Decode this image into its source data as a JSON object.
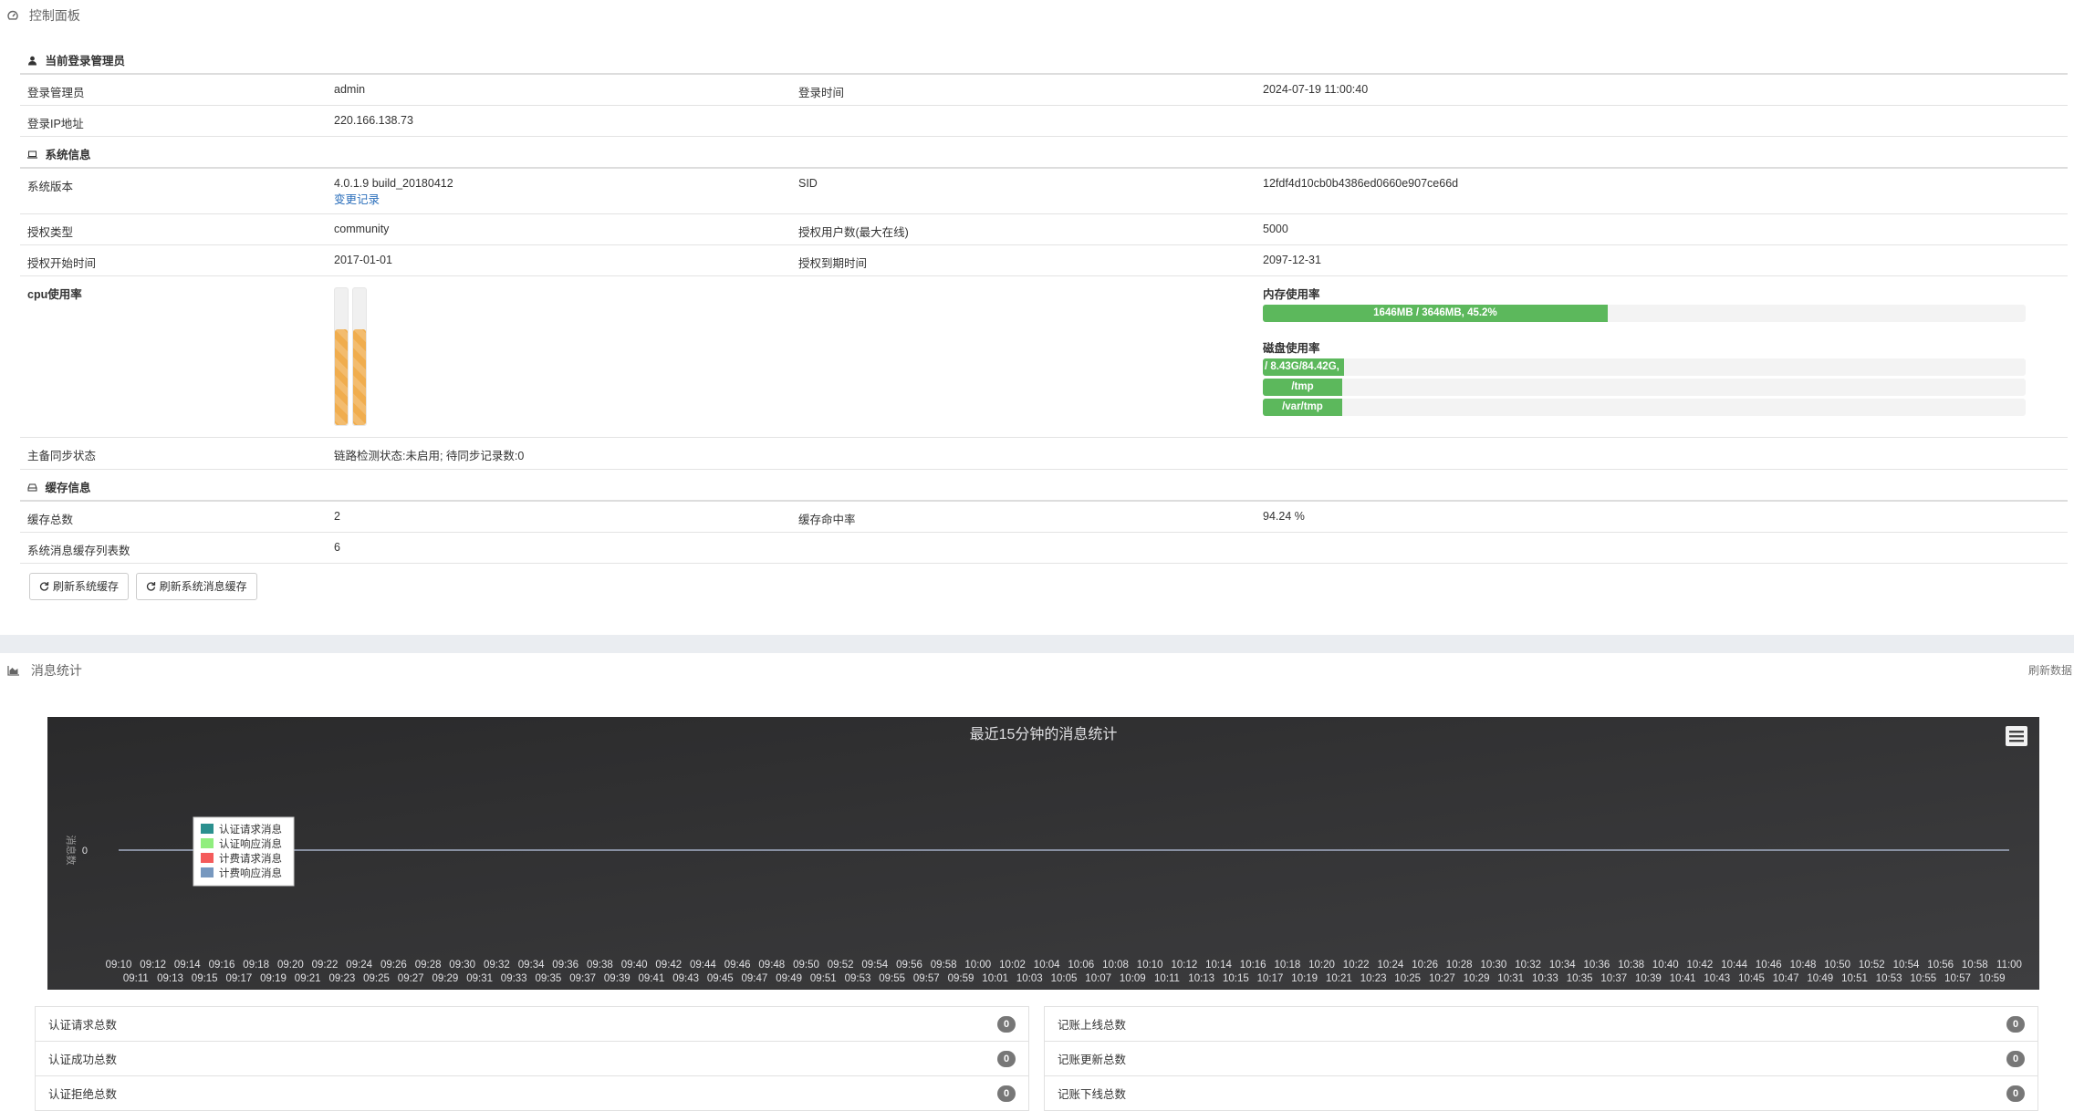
{
  "dashboard": {
    "title": "控制面板"
  },
  "admin_section": {
    "title": "当前登录管理员",
    "login_admin_label": "登录管理员",
    "login_admin_value": "admin",
    "login_time_label": "登录时间",
    "login_time_value": "2024-07-19 11:00:40",
    "login_ip_label": "登录IP地址",
    "login_ip_value": "220.166.138.73"
  },
  "system_section": {
    "title": "系统信息",
    "version_label": "系统版本",
    "version_value": "4.0.1.9 build_20180412",
    "changelog_link": "变更记录",
    "sid_label": "SID",
    "sid_value": "12fdf4d10cb0b4386ed0660e907ce66d",
    "license_type_label": "授权类型",
    "license_type_value": "community",
    "license_users_label": "授权用户数(最大在线)",
    "license_users_value": "5000",
    "license_start_label": "授权开始时间",
    "license_start_value": "2017-01-01",
    "license_end_label": "授权到期时间",
    "license_end_value": "2097-12-31",
    "cpu_label": "cpu使用率",
    "cpu_usage": [
      0.7,
      0.7
    ],
    "mem_label": "内存使用率",
    "mem_text": "1646MB / 3646MB, 45.2%",
    "mem_fraction": 0.452,
    "disk_label": "磁盘使用率",
    "disks": [
      {
        "text": "/ 8.43G/84.42G,",
        "fraction": 0.104
      },
      {
        "text": "/tmp",
        "fraction": 0.104
      },
      {
        "text": "/var/tmp",
        "fraction": 0.104
      }
    ],
    "sync_label": "主备同步状态",
    "sync_value": "链路检测状态:未启用; 待同步记录数:0"
  },
  "cache_section": {
    "title": "缓存信息",
    "total_label": "缓存总数",
    "total_value": "2",
    "hit_label": "缓存命中率",
    "hit_value": "94.24 %",
    "msg_cache_label": "系统消息缓存列表数",
    "msg_cache_value": "6"
  },
  "buttons": {
    "refresh_cache": "刷新系统缓存",
    "refresh_msg_cache": "刷新系统消息缓存"
  },
  "message_stats": {
    "title": "消息统计",
    "refresh_link": "刷新数据"
  },
  "chart_data": {
    "type": "line",
    "title": "最近15分钟的消息统计",
    "ylabel": "消息数",
    "xlabel": "",
    "y_ticks": [
      "0"
    ],
    "x": [
      "09:10",
      "09:11",
      "09:12",
      "09:13",
      "09:14",
      "09:15",
      "09:16",
      "09:17",
      "09:18",
      "09:19",
      "09:20",
      "09:21",
      "09:22",
      "09:23",
      "09:24",
      "09:25",
      "09:26",
      "09:27",
      "09:28",
      "09:29",
      "09:30",
      "09:31",
      "09:32",
      "09:33",
      "09:34",
      "09:35",
      "09:36",
      "09:37",
      "09:38",
      "09:39",
      "09:40",
      "09:41",
      "09:42",
      "09:43",
      "09:44",
      "09:45",
      "09:46",
      "09:47",
      "09:48",
      "09:49",
      "09:50",
      "09:51",
      "09:52",
      "09:53",
      "09:54",
      "09:55",
      "09:56",
      "09:57",
      "09:58",
      "09:59",
      "10:00",
      "10:01",
      "10:02",
      "10:03",
      "10:04",
      "10:05",
      "10:06",
      "10:07",
      "10:08",
      "10:09",
      "10:10",
      "10:11",
      "10:12",
      "10:13",
      "10:14",
      "10:15",
      "10:16",
      "10:17",
      "10:18",
      "10:19",
      "10:20",
      "10:21",
      "10:22",
      "10:23",
      "10:24",
      "10:25",
      "10:26",
      "10:27",
      "10:28",
      "10:29",
      "10:30",
      "10:31",
      "10:32",
      "10:33",
      "10:34",
      "10:35",
      "10:36",
      "10:37",
      "10:38",
      "10:39",
      "10:40",
      "10:41",
      "10:42",
      "10:43",
      "10:44",
      "10:45",
      "10:46",
      "10:47",
      "10:48",
      "10:49",
      "10:50",
      "10:51",
      "10:52",
      "10:53",
      "10:54",
      "10:55",
      "10:56",
      "10:57",
      "10:58",
      "10:59",
      "11:00"
    ],
    "series": [
      {
        "name": "认证请求消息",
        "color": "#2b908f",
        "values_all": 0
      },
      {
        "name": "认证响应消息",
        "color": "#90ee7e",
        "values_all": 0
      },
      {
        "name": "计费请求消息",
        "color": "#f45b5b",
        "values_all": 0
      },
      {
        "name": "计费响应消息",
        "color": "#7798bf",
        "values_all": 0
      }
    ],
    "legend": "top-left",
    "grid": false,
    "background": "#3e3e40"
  },
  "stats": {
    "left": [
      {
        "label": "认证请求总数",
        "count": "0"
      },
      {
        "label": "认证成功总数",
        "count": "0"
      },
      {
        "label": "认证拒绝总数",
        "count": "0"
      }
    ],
    "right": [
      {
        "label": "记账上线总数",
        "count": "0"
      },
      {
        "label": "记账更新总数",
        "count": "0"
      },
      {
        "label": "记账下线总数",
        "count": "0"
      }
    ]
  }
}
